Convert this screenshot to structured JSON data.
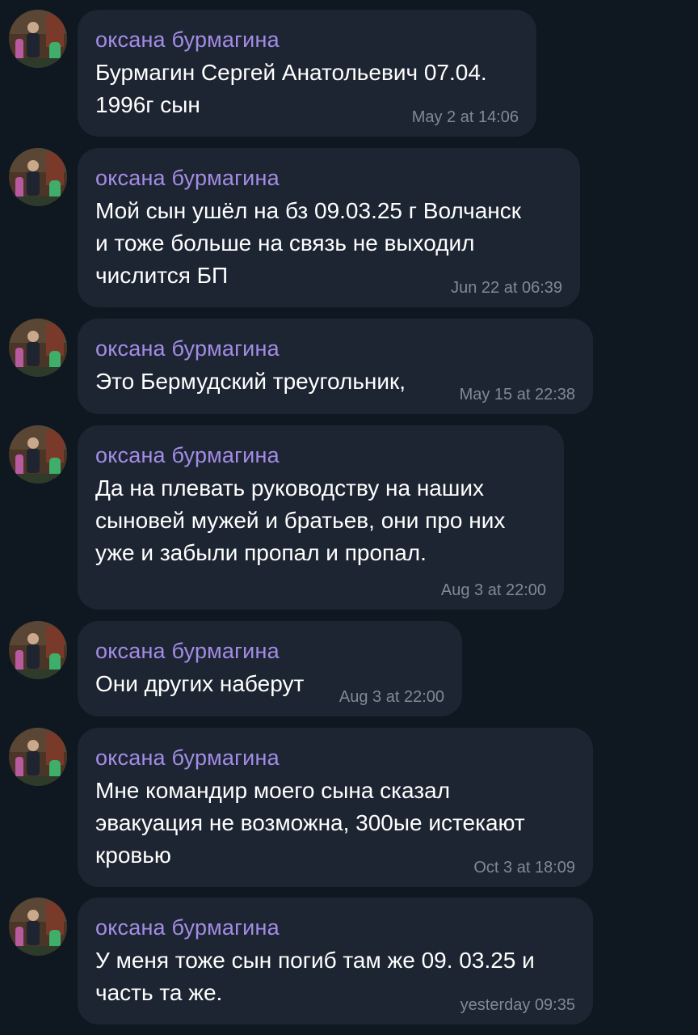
{
  "messages": [
    {
      "sender": "оксана бурмагина",
      "text": "Бурмагин Сергей Анатольевич 07.04.\n1996г сын",
      "time": "May 2 at 14:06"
    },
    {
      "sender": "оксана бурмагина",
      "text": "Мой сын ушёл на бз 09.03.25 г Волчанск\nи тоже больше на связь не выходил\nчислится БП",
      "time": "Jun 22 at 06:39"
    },
    {
      "sender": "оксана бурмагина",
      "text": "Это Бермудский треугольник,",
      "time": "May 15 at 22:38"
    },
    {
      "sender": "оксана бурмагина",
      "text": "Да на плевать руководству на наших\nсыновей мужей и братьев, они про них\nуже и забыли пропал и пропал.",
      "time": "Aug 3 at 22:00"
    },
    {
      "sender": "оксана бурмагина",
      "text": "Они других наберут",
      "time": "Aug 3 at 22:00"
    },
    {
      "sender": "оксана бурмагина",
      "text": "Мне командир моего сына сказал\nэвакуация не возможна, 300ые истекают\nкровью",
      "time": "Oct 3 at 18:09"
    },
    {
      "sender": "оксана бурмагина",
      "text": "У меня тоже сын погиб там же 09. 03.25 и\nчасть та же.",
      "time": "yesterday 09:35"
    }
  ],
  "colors": {
    "background": "#0f1720",
    "bubble": "#1c2531",
    "sender": "#a48ce6",
    "text": "#ffffff",
    "time": "#7f8a98"
  }
}
